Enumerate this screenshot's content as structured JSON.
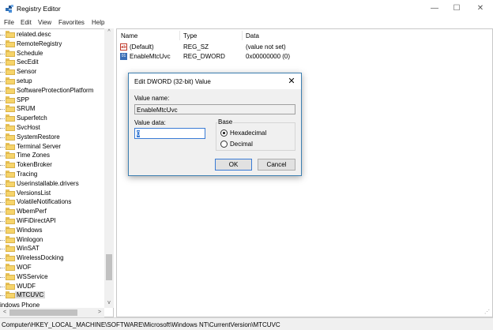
{
  "window": {
    "title": "Registry Editor",
    "minimize_glyph": "—",
    "maximize_glyph": "☐",
    "close_glyph": "✕"
  },
  "menu": [
    "File",
    "Edit",
    "View",
    "Favorites",
    "Help"
  ],
  "tree": {
    "items": [
      "related.desc",
      "RemoteRegistry",
      "Schedule",
      "SecEdit",
      "Sensor",
      "setup",
      "SoftwareProtectionPlatform",
      "SPP",
      "SRUM",
      "Superfetch",
      "SvcHost",
      "SystemRestore",
      "Terminal Server",
      "Time Zones",
      "TokenBroker",
      "Tracing",
      "Userinstallable.drivers",
      "VersionsList",
      "VolatileNotifications",
      "WbemPerf",
      "WiFiDirectAPI",
      "Windows",
      "Winlogon",
      "WinSAT",
      "WirelessDocking",
      "WOF",
      "WSService",
      "WUDF",
      "MTCUVC"
    ],
    "selected": "MTCUVC",
    "partial_row": "indows Phone",
    "scroll_up": "^",
    "scroll_down": "v",
    "scroll_left": "<",
    "scroll_right": ">"
  },
  "list": {
    "headers": {
      "name": "Name",
      "type": "Type",
      "data": "Data"
    },
    "rows": [
      {
        "icon": "string-value-icon",
        "icon_text": "ab",
        "name": "(Default)",
        "type": "REG_SZ",
        "data": "(value not set)"
      },
      {
        "icon": "binary-value-icon",
        "icon_text": "01",
        "name": "EnableMtcUvc",
        "type": "REG_DWORD",
        "data": "0x00000000 (0)"
      }
    ]
  },
  "statusbar": {
    "path": "Computer\\HKEY_LOCAL_MACHINE\\SOFTWARE\\Microsoft\\Windows NT\\CurrentVersion\\MTCUVC"
  },
  "dialog": {
    "title": "Edit DWORD (32-bit) Value",
    "close_glyph": "✕",
    "value_name_label": "Value name:",
    "value_name": "EnableMtcUvc",
    "value_data_label": "Value data:",
    "value_data": "0",
    "base_label": "Base",
    "hex_label": "Hexadecimal",
    "dec_label": "Decimal",
    "base_selected": "Hexadecimal",
    "ok_label": "OK",
    "cancel_label": "Cancel"
  },
  "colors": {
    "folder": "#f6d46a",
    "accent": "#3a7bd5",
    "selection": "#d9d9d9"
  }
}
